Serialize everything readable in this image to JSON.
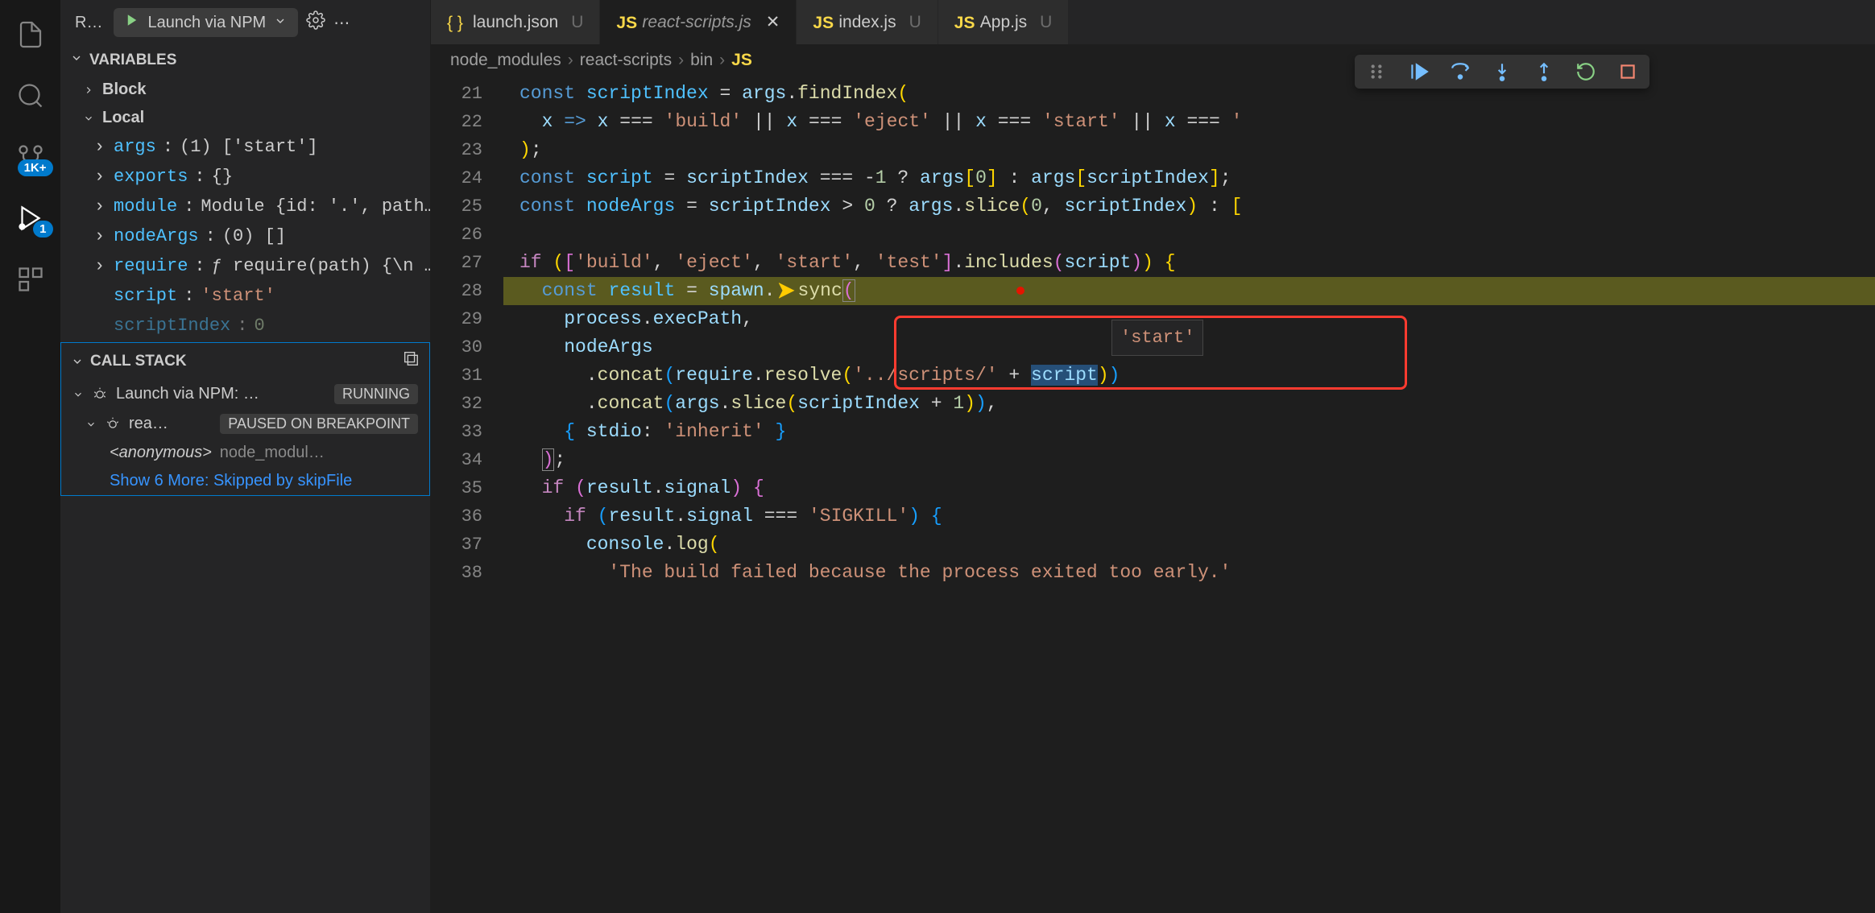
{
  "activity": {
    "badges": {
      "scm": "1K+",
      "debug": "1"
    }
  },
  "debugToolbar": {
    "label": "R…",
    "configName": "Launch via NPM"
  },
  "sections": {
    "variables": "VARIABLES",
    "callstack": "CALL STACK"
  },
  "scopes": {
    "block": "Block",
    "local": "Local"
  },
  "variables": [
    {
      "name": "args",
      "value": "(1) ['start']",
      "expandable": true
    },
    {
      "name": "exports",
      "value": "{}",
      "expandable": true
    },
    {
      "name": "module",
      "value": "Module {id: '.', path…",
      "expandable": true
    },
    {
      "name": "nodeArgs",
      "value": "(0) []",
      "expandable": true
    },
    {
      "name": "require",
      "value": "ƒ require(path) {\\n …",
      "expandable": true
    },
    {
      "name": "script",
      "value": "'start'",
      "expandable": false,
      "isString": true
    },
    {
      "name": "scriptIndex",
      "value": "0",
      "expandable": false,
      "isNumber": true
    }
  ],
  "callstack": {
    "threads": [
      {
        "name": "Launch via NPM: …",
        "status": "RUNNING"
      },
      {
        "name": "rea…",
        "status": "PAUSED ON BREAKPOINT"
      }
    ],
    "frame": {
      "fn": "<anonymous>",
      "loc": "node_modul…"
    },
    "showMore": "Show 6 More: Skipped by skipFile"
  },
  "tabs": [
    {
      "label": "launch.json",
      "status": "U",
      "icon": "json",
      "active": false
    },
    {
      "label": "react-scripts.js",
      "status": "",
      "icon": "js",
      "active": true,
      "modified": true,
      "closable": true
    },
    {
      "label": "index.js",
      "status": "U",
      "icon": "js",
      "active": false
    },
    {
      "label": "App.js",
      "status": "U",
      "icon": "js",
      "active": false
    }
  ],
  "breadcrumbs": [
    "node_modules",
    "react-scripts",
    "bin"
  ],
  "breadcrumbFile": {
    "icon": "JS",
    "visible": ""
  },
  "code": {
    "startLine": 21,
    "lines": [
      "const scriptIndex = args.findIndex(",
      "  x => x === 'build' || x === 'eject' || x === 'start' || x === '",
      ");",
      "const script = scriptIndex === -1 ? args[0] : args[scriptIndex];",
      "const nodeArgs = scriptIndex > 0 ? args.slice(0, scriptIndex) : [",
      "",
      "if (['build', 'eject', 'start', 'test'].includes(script)) {",
      "  const result = spawn.sync(",
      "    process.execPath,",
      "    nodeArgs",
      "      .concat(require.resolve('../scripts/' + script))",
      "      .concat(args.slice(scriptIndex + 1)),",
      "    { stdio: 'inherit' }",
      "  );",
      "  if (result.signal) {",
      "    if (result.signal === 'SIGKILL') {",
      "      console.log(",
      "        'The build failed because the process exited too early.'"
    ],
    "currentLine": 28,
    "hoverValue": "'start'"
  }
}
